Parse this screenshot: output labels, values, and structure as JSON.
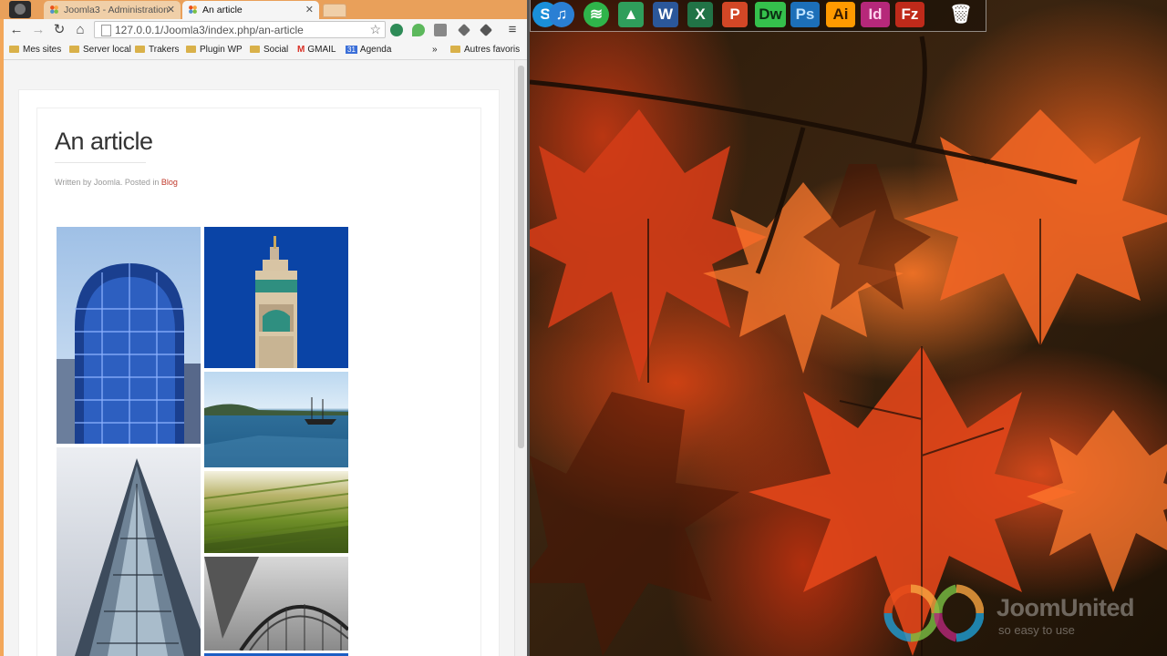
{
  "browser": {
    "tabs": [
      {
        "label": "Joomla3 - Administration",
        "active": false
      },
      {
        "label": "An article",
        "active": true
      }
    ],
    "address": "127.0.0.1/Joomla3/index.php/an-article",
    "bookmarks": [
      "Mes sites",
      "Server local",
      "Trakers",
      "Plugin WP",
      "Social",
      "GMAIL",
      "Agenda",
      "Autres favoris"
    ],
    "bookmarks_overflow": "»",
    "agenda_badge": "31",
    "gmail_badge": "M"
  },
  "article": {
    "title": "An article",
    "meta_prefix": "Written by Joomla. Posted in ",
    "category": "Blog"
  },
  "gallery": {
    "images": [
      "blue-glass-tower",
      "minaret-tower",
      "sailboat-bay",
      "mossy-roof",
      "glass-spire",
      "steel-arch-bridge",
      "blue-strip"
    ]
  },
  "desktop": {
    "apps": [
      {
        "name": "skype",
        "label": "S",
        "color": "#1a8fd8"
      },
      {
        "name": "itunes",
        "label": "♫",
        "color": "#2a7fd4"
      },
      {
        "name": "spotify",
        "label": "≋",
        "color": "#2fb44a"
      },
      {
        "name": "google-drive",
        "label": "▲",
        "color": "#2f9e5b"
      },
      {
        "name": "word",
        "label": "W",
        "color": "#2b579a"
      },
      {
        "name": "excel",
        "label": "X",
        "color": "#217346"
      },
      {
        "name": "powerpoint",
        "label": "P",
        "color": "#d24726"
      },
      {
        "name": "dreamweaver",
        "label": "Dw",
        "color": "#35c04c"
      },
      {
        "name": "photoshop",
        "label": "Ps",
        "color": "#1c6fb8"
      },
      {
        "name": "illustrator",
        "label": "Ai",
        "color": "#ff9a00"
      },
      {
        "name": "indesign",
        "label": "Id",
        "color": "#b6287a"
      },
      {
        "name": "filezilla",
        "label": "Fz",
        "color": "#bf2a1a"
      },
      {
        "name": "recycle-bin",
        "label": "🗑",
        "color": "#8db8d8"
      }
    ],
    "brand": {
      "name": "JoomUnited",
      "tagline": "so easy to use"
    }
  }
}
